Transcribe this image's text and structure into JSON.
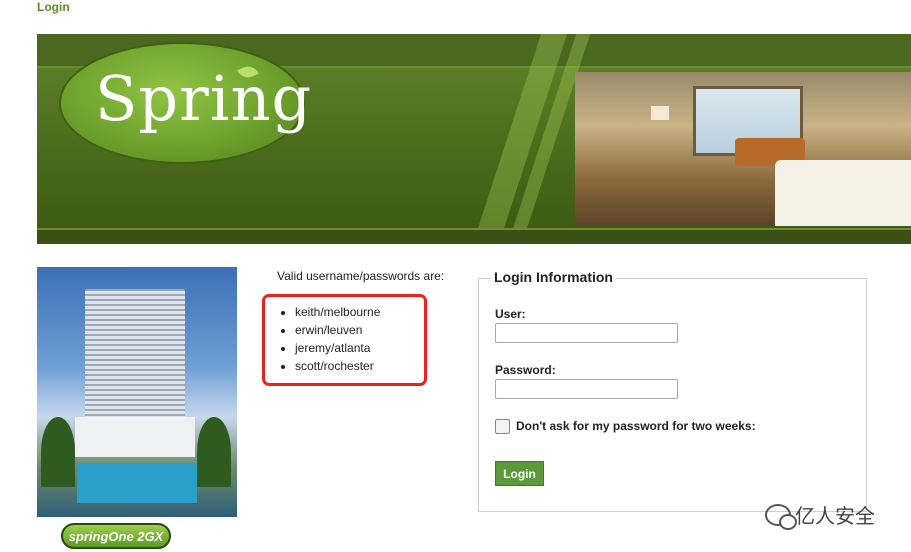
{
  "header": {
    "top_link": "Login"
  },
  "banner": {
    "logo_text": "Spring"
  },
  "sidebar": {
    "badge_text": "springOne 2GX"
  },
  "credentials": {
    "title": "Valid username/passwords are:",
    "items": [
      "keith/melbourne",
      "erwin/leuven",
      "jeremy/atlanta",
      "scott/rochester"
    ]
  },
  "login_form": {
    "legend": "Login Information",
    "user_label": "User:",
    "user_value": "",
    "password_label": "Password:",
    "password_value": "",
    "remember_label": "Don't ask for my password for two weeks:",
    "remember_checked": false,
    "submit_label": "Login"
  },
  "watermark": {
    "text": "亿人安全"
  },
  "colors": {
    "accent": "#5a9a3a",
    "highlight": "#e8231c",
    "banner": "#4f6b22"
  },
  "icons": {
    "watermark": "wechat-icon"
  }
}
